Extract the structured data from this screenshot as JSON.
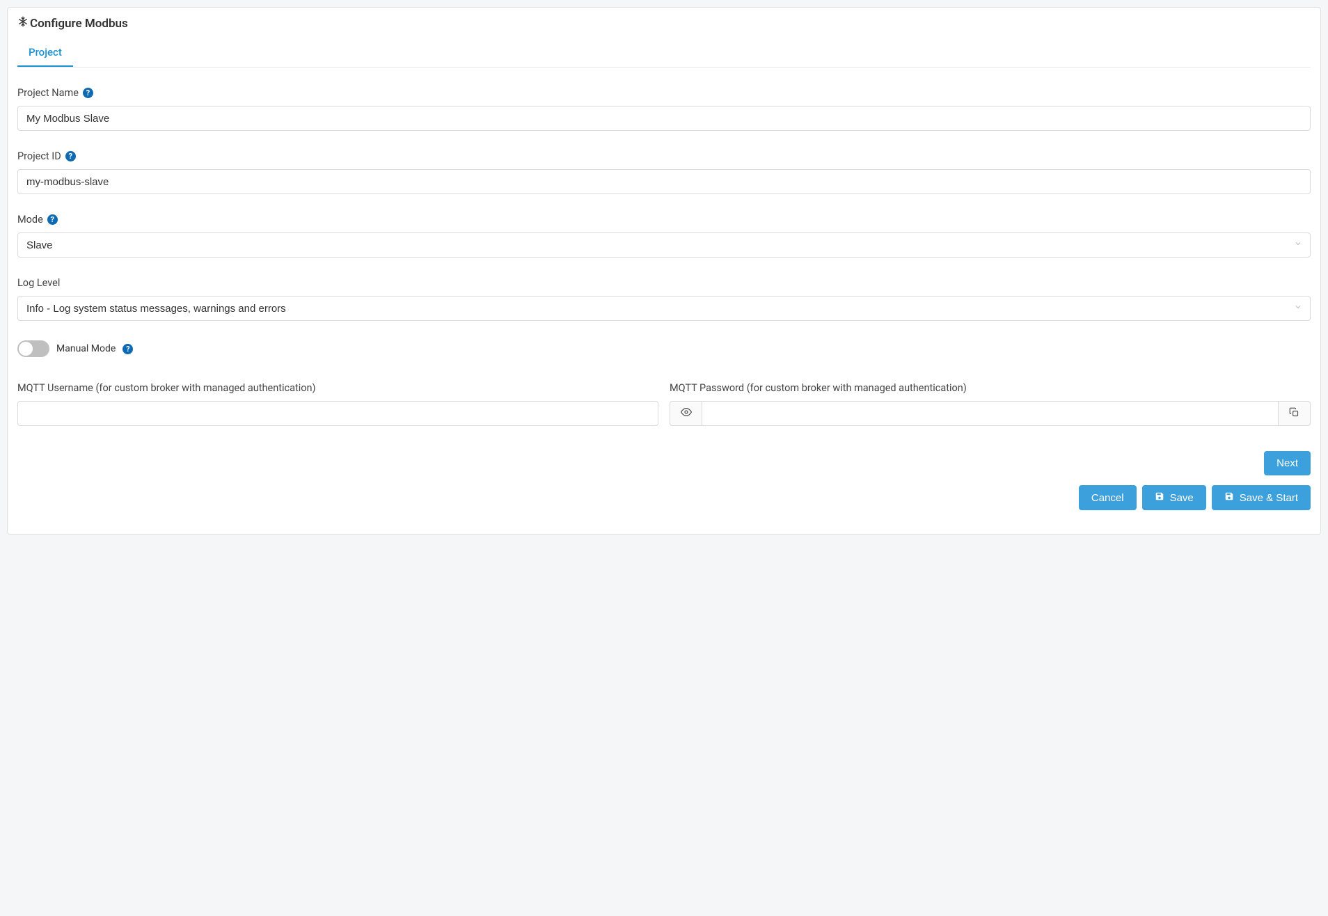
{
  "header": {
    "title": "Configure Modbus"
  },
  "tabs": [
    {
      "label": "Project",
      "active": true
    }
  ],
  "form": {
    "project_name": {
      "label": "Project Name",
      "value": "My Modbus Slave"
    },
    "project_id": {
      "label": "Project ID",
      "value": "my-modbus-slave"
    },
    "mode": {
      "label": "Mode",
      "value": "Slave"
    },
    "log_level": {
      "label": "Log Level",
      "value": "Info - Log system status messages, warnings and errors"
    },
    "manual_mode": {
      "label": "Manual Mode",
      "value": false
    },
    "mqtt_username": {
      "label": "MQTT Username (for custom broker with managed authentication)",
      "value": ""
    },
    "mqtt_password": {
      "label": "MQTT Password (for custom broker with managed authentication)",
      "value": ""
    }
  },
  "buttons": {
    "next": "Next",
    "cancel": "Cancel",
    "save": "Save",
    "save_start": "Save & Start"
  }
}
